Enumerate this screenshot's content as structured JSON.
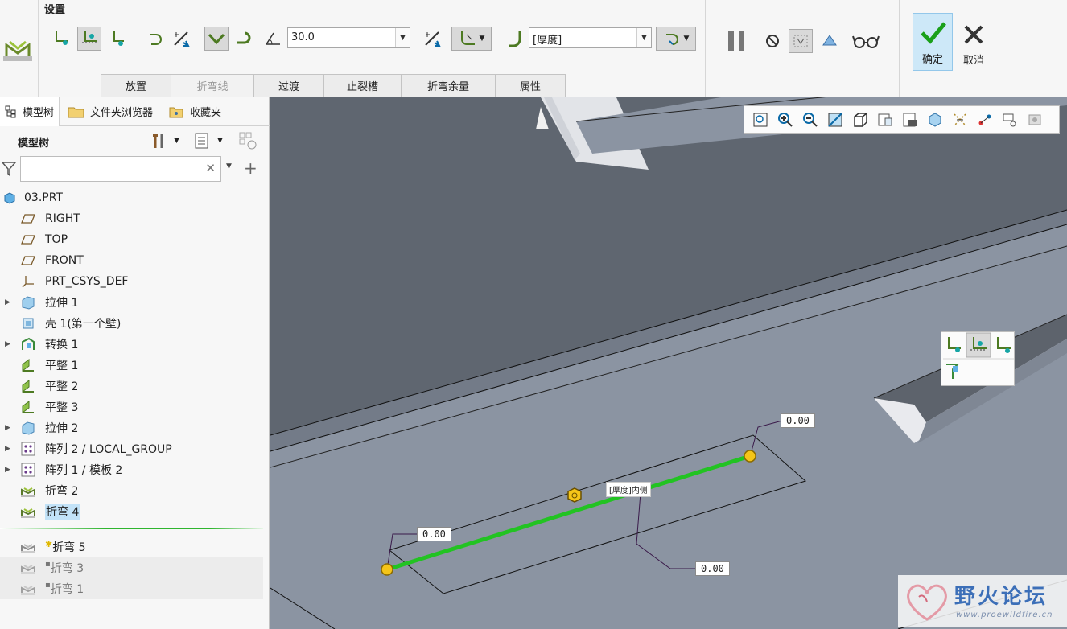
{
  "ribbon": {
    "settings_label": "设置",
    "angle_value": "30.0",
    "thickness_value": "[厚度]",
    "tabs": [
      "放置",
      "折弯线",
      "过渡",
      "止裂槽",
      "折弯余量",
      "属性"
    ],
    "ok_label": "确定",
    "cancel_label": "取消",
    "accent_color": "#16a5a5"
  },
  "panel": {
    "tabs": [
      "模型树",
      "文件夹浏览器",
      "收藏夹"
    ],
    "tree_header": "模型树",
    "filter_placeholder": "",
    "items": [
      {
        "label": "03.PRT",
        "icon": "part-icon"
      },
      {
        "label": "RIGHT",
        "icon": "datum-plane-icon"
      },
      {
        "label": "TOP",
        "icon": "datum-plane-icon"
      },
      {
        "label": "FRONT",
        "icon": "datum-plane-icon"
      },
      {
        "label": "PRT_CSYS_DEF",
        "icon": "csys-icon"
      },
      {
        "label": "拉伸 1",
        "icon": "extrude-icon"
      },
      {
        "label": "壳 1(第一个壁)",
        "icon": "shell-icon"
      },
      {
        "label": "转换 1",
        "icon": "convert-icon"
      },
      {
        "label": "平整 1",
        "icon": "flat-wall-icon"
      },
      {
        "label": "平整 2",
        "icon": "flat-wall-icon"
      },
      {
        "label": "平整 3",
        "icon": "flat-wall-icon"
      },
      {
        "label": "拉伸 2",
        "icon": "extrude-icon"
      },
      {
        "label": "阵列 2 / LOCAL_GROUP",
        "icon": "pattern-icon"
      },
      {
        "label": "阵列 1 / 模板 2",
        "icon": "pattern-icon"
      },
      {
        "label": "折弯 2",
        "icon": "bend-icon"
      },
      {
        "label": "折弯 4",
        "icon": "bend-icon"
      },
      {
        "label": "折弯 5",
        "icon": "bend-icon"
      },
      {
        "label": "折弯 3",
        "icon": "bend-icon"
      },
      {
        "label": "折弯 1",
        "icon": "bend-icon"
      }
    ]
  },
  "viewport": {
    "dim_top": "0.00",
    "dim_left": "0.00",
    "dim_bottom": "0.00",
    "label_tag": "[厚度]内侧",
    "highlight_color": "#22c322",
    "handle_color": "#f5c518"
  },
  "watermark": {
    "title": "野火论坛",
    "url": "www.proewildfire.cn"
  }
}
